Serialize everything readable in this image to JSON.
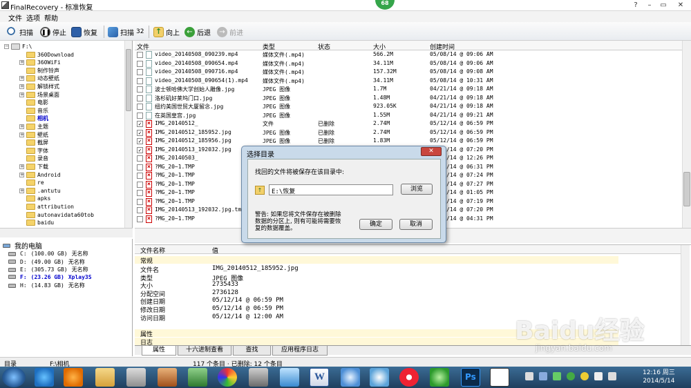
{
  "window": {
    "title": "FinalRecovery - 标准恢复",
    "badge": "68"
  },
  "menu": [
    "文件",
    "选项",
    "帮助"
  ],
  "toolbar": {
    "scan": "扫描",
    "stop": "停止",
    "recover": "恢复",
    "scan_count_label": "扫描",
    "scan_count": "32",
    "up": "向上",
    "back": "后退",
    "forward": "前进"
  },
  "tree": {
    "root": "F:\\",
    "items": [
      "360Download",
      "360WiFi",
      "制作铃声",
      "动态壁纸",
      "解锁样式",
      "场景桌面",
      "电影",
      "音乐",
      "相机",
      "主题",
      "壁纸",
      "截屏",
      "字体",
      "录音",
      "下载",
      "Android",
      "re",
      ".antutu",
      "apks",
      "attribution",
      "autonavidata60tob",
      "baidu"
    ],
    "selected": "相机"
  },
  "computer": {
    "label": "我的电脑",
    "drives": [
      {
        "letter": "C:",
        "size": "(100.00 GB)",
        "name": "无名称"
      },
      {
        "letter": "D:",
        "size": "(49.00 GB)",
        "name": "无名称"
      },
      {
        "letter": "E:",
        "size": "(305.73 GB)",
        "name": "无名称"
      },
      {
        "letter": "F:",
        "size": "(23.26 GB)",
        "name": "Xplay3S"
      },
      {
        "letter": "H:",
        "size": "(14.83 GB)",
        "name": "无名称"
      }
    ]
  },
  "filelist": {
    "headers": [
      "文件",
      "类型",
      "状态",
      "大小",
      "创建时间"
    ],
    "rows": [
      {
        "checked": false,
        "deleted": false,
        "name": "video_20140508_090239.mp4",
        "type": "媒体文件(.mp4)",
        "status": "",
        "size": "566.2M",
        "created": "05/08/14 @ 09:06 AM"
      },
      {
        "checked": false,
        "deleted": false,
        "name": "video_20140508_090654.mp4",
        "type": "媒体文件(.mp4)",
        "status": "",
        "size": "34.11M",
        "created": "05/08/14 @ 09:06 AM"
      },
      {
        "checked": false,
        "deleted": false,
        "name": "video_20140508_090716.mp4",
        "type": "媒体文件(.mp4)",
        "status": "",
        "size": "157.32M",
        "created": "05/08/14 @ 09:08 AM"
      },
      {
        "checked": false,
        "deleted": false,
        "name": "video_20140508_090654(1).mp4",
        "type": "媒体文件(.mp4)",
        "status": "",
        "size": "34.11M",
        "created": "05/08/14 @ 10:31 AM"
      },
      {
        "checked": false,
        "deleted": false,
        "name": "波士顿哈佛大学创始人雕像.jpg",
        "type": "JPEG 图像",
        "status": "",
        "size": "1.7M",
        "created": "04/21/14 @ 09:18 AM"
      },
      {
        "checked": false,
        "deleted": false,
        "name": "洛杉矶好莱坞门口.jpg",
        "type": "JPEG 图像",
        "status": "",
        "size": "1.48M",
        "created": "04/21/14 @ 09:18 AM"
      },
      {
        "checked": false,
        "deleted": false,
        "name": "纽约美国世贸大厦留念.jpg",
        "type": "JPEG 图像",
        "status": "",
        "size": "923.05K",
        "created": "04/21/14 @ 09:18 AM"
      },
      {
        "checked": false,
        "deleted": false,
        "name": "在英国皇宫.jpg",
        "type": "JPEG 图像",
        "status": "",
        "size": "1.55M",
        "created": "04/21/14 @ 09:21 AM"
      },
      {
        "checked": true,
        "deleted": true,
        "name": "IMG_20140512_",
        "type": "文件",
        "status": "已删除",
        "size": "2.74M",
        "created": "05/12/14 @ 06:59 PM"
      },
      {
        "checked": true,
        "deleted": true,
        "name": "IMG_20140512_185952.jpg",
        "type": "JPEG 图像",
        "status": "已删除",
        "size": "2.74M",
        "created": "05/12/14 @ 06:59 PM"
      },
      {
        "checked": true,
        "deleted": true,
        "name": "IMG_20140512_185956.jpg",
        "type": "JPEG 图像",
        "status": "已删除",
        "size": "1.83M",
        "created": "05/12/14 @ 06:59 PM"
      },
      {
        "checked": true,
        "deleted": true,
        "name": "IMG_20140513_192032.jpg",
        "type": "",
        "status": "",
        "size": "",
        "created": "05/13/14 @ 07:20 PM"
      },
      {
        "checked": false,
        "deleted": true,
        "name": "IMG_20140503_",
        "type": "",
        "status": "",
        "size": "",
        "created": "05/03/14 @ 12:26 PM"
      },
      {
        "checked": false,
        "deleted": true,
        "name": "?MG_20~1.TMP",
        "type": "",
        "status": "",
        "size": "",
        "created": "05/12/14 @ 06:31 PM"
      },
      {
        "checked": false,
        "deleted": true,
        "name": "?MG_20~1.TMP",
        "type": "",
        "status": "",
        "size": "",
        "created": "05/12/14 @ 07:24 PM"
      },
      {
        "checked": false,
        "deleted": true,
        "name": "?MG_20~1.TMP",
        "type": "",
        "status": "",
        "size": "",
        "created": "05/12/14 @ 07:27 PM"
      },
      {
        "checked": false,
        "deleted": true,
        "name": "?MG_20~1.TMP",
        "type": "",
        "status": "",
        "size": "",
        "created": "05/12/14 @ 01:05 PM"
      },
      {
        "checked": false,
        "deleted": true,
        "name": "?MG_20~1.TMP",
        "type": "",
        "status": "",
        "size": "",
        "created": "05/12/14 @ 07:19 PM"
      },
      {
        "checked": false,
        "deleted": true,
        "name": "IMG_20140513_192032.jpg.tmp",
        "type": "",
        "status": "",
        "size": "",
        "created": "05/13/14 @ 07:20 PM"
      },
      {
        "checked": false,
        "deleted": true,
        "name": "?MG_20~1.TMP",
        "type": "",
        "status": "",
        "size": "",
        "created": "05/12/14 @ 04:31 PM"
      }
    ]
  },
  "props": {
    "headers": [
      "文件名称",
      "值"
    ],
    "group1": "常规",
    "rows": [
      {
        "k": "文件名",
        "v": "IMG_20140512_185952.jpg"
      },
      {
        "k": "类型",
        "v": "JPEG 图像"
      },
      {
        "k": "大小",
        "v": "2735433"
      },
      {
        "k": "分配空间",
        "v": "2736128"
      },
      {
        "k": "创建日期",
        "v": "05/12/14 @ 06:59 PM"
      },
      {
        "k": "修改日期",
        "v": "05/12/14 @ 06:59 PM"
      },
      {
        "k": "访问日期",
        "v": "05/12/14 @ 12:00 AM"
      }
    ],
    "group2": "属性",
    "group3": "日志"
  },
  "tabs": [
    "属性",
    "十六进制查看",
    "查找",
    "应用程序日志"
  ],
  "status": {
    "dir_label": "目录",
    "path": "F:\\相机",
    "count": "117 个条目 · 已删除: 12 个条目"
  },
  "dialog": {
    "title": "选择目录",
    "prompt": "找回的文件将被保存在该目录中:",
    "path": "E:\\恢复",
    "browse": "浏览",
    "warning": "警告: 如果您将文件保存在被删除数据的分区上, 则有可能将需要恢复的数据覆盖。",
    "ok": "确定",
    "cancel": "取消"
  },
  "clock": {
    "time": "12:16 周三",
    "date": "2014/5/14"
  },
  "watermark": {
    "brand": "Baidu经验",
    "url": "jingyan.baidu.com"
  }
}
